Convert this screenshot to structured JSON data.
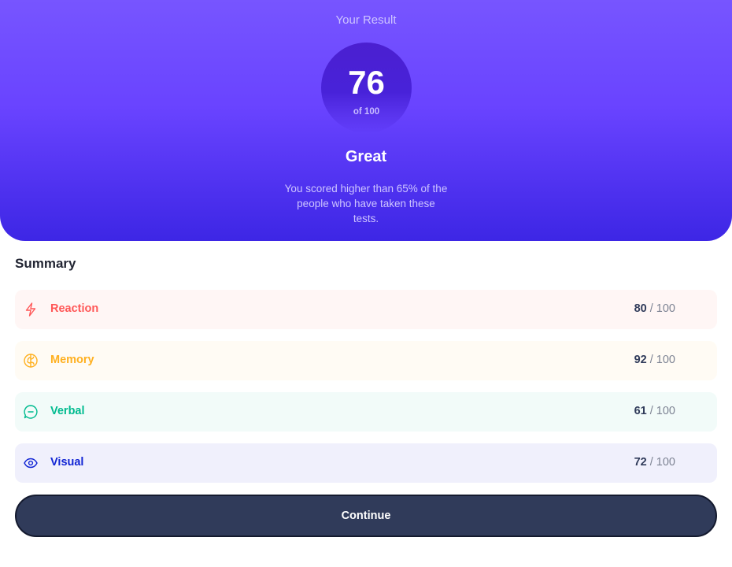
{
  "result": {
    "heading": "Your Result",
    "score": "76",
    "score_total": "of 100",
    "rating": "Great",
    "description": "You scored higher than 65% of the people who have taken these tests."
  },
  "summary": {
    "title": "Summary",
    "items": [
      {
        "label": "Reaction",
        "score": "80",
        "max": " / 100",
        "icon": "lightning-icon",
        "color": "#ff5757"
      },
      {
        "label": "Memory",
        "score": "92",
        "max": " / 100",
        "icon": "brain-icon",
        "color": "#ffb01f"
      },
      {
        "label": "Verbal",
        "score": "61",
        "max": " / 100",
        "icon": "chat-bubble-icon",
        "color": "#00bb8f"
      },
      {
        "label": "Visual",
        "score": "72",
        "max": " / 100",
        "icon": "eye-icon",
        "color": "#1125d4"
      }
    ]
  },
  "continue_button": {
    "label": "Continue"
  },
  "colors": {
    "gradient_top": "#7755ff",
    "gradient_bottom": "#3d26e5",
    "circle": "#4b1fd0",
    "button_bg": "#303b5a"
  }
}
